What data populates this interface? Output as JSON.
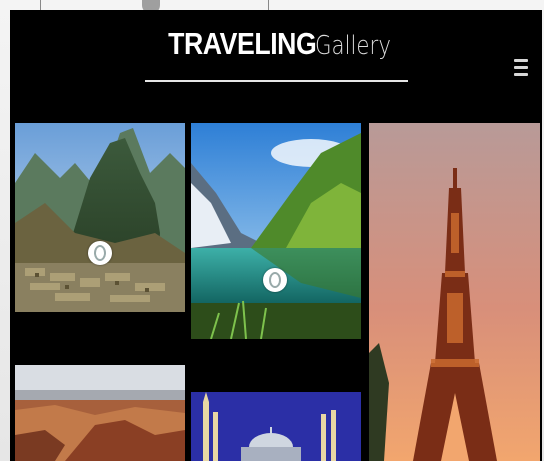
{
  "brand": {
    "bold": "TRAVELING",
    "light": "Gallery"
  },
  "menu": {
    "icon": "hamburger-menu-icon"
  },
  "gallery": {
    "items": [
      {
        "subject": "mountain ruins",
        "pin": "location-pin-icon"
      },
      {
        "subject": "alpine lake",
        "pin": "location-pin-icon"
      },
      {
        "subject": "tower at sunset",
        "pin": ""
      },
      {
        "subject": "canyon",
        "pin": ""
      },
      {
        "subject": "domed mosque",
        "pin": ""
      }
    ]
  },
  "colors": {
    "background": "#000000",
    "text": "#ffffff",
    "divider": "#e6e6e6"
  }
}
